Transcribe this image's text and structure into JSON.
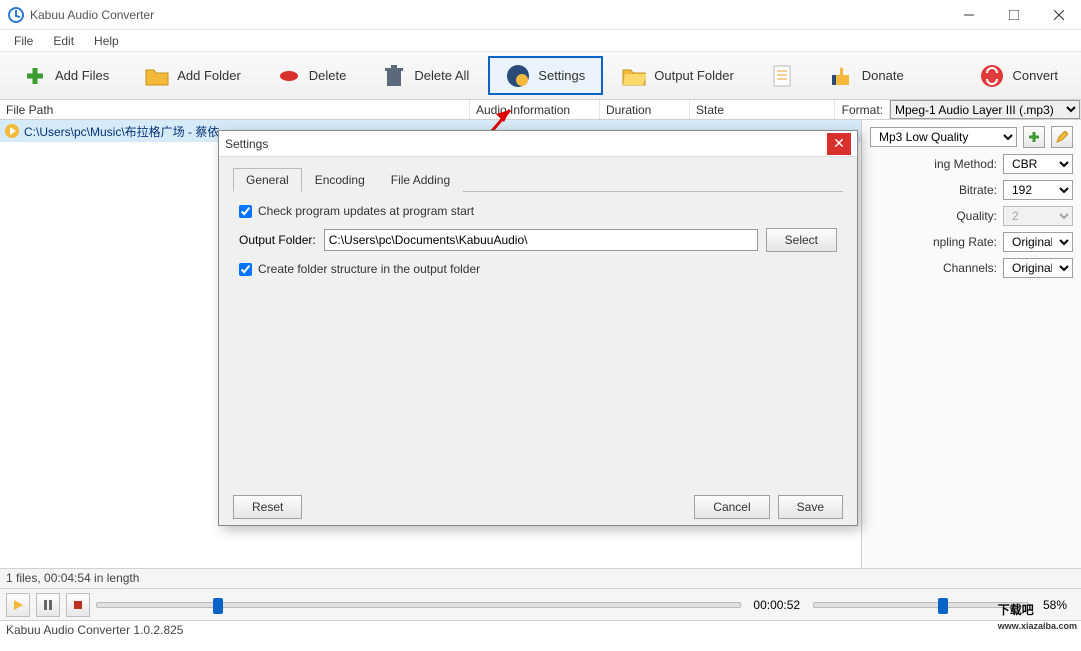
{
  "app": {
    "title": "Kabuu Audio Converter"
  },
  "menubar": {
    "file": "File",
    "edit": "Edit",
    "help": "Help"
  },
  "toolbar": {
    "add_files": "Add Files",
    "add_folder": "Add Folder",
    "delete": "Delete",
    "delete_all": "Delete All",
    "settings": "Settings",
    "output_folder": "Output Folder",
    "donate": "Donate",
    "convert": "Convert"
  },
  "columns": {
    "file_path": "File Path",
    "audio_info": "Audio Information",
    "duration": "Duration",
    "state": "State"
  },
  "filelist": {
    "row0": {
      "path": "C:\\Users\\pc\\Music\\布拉格广场 - 蔡依"
    }
  },
  "side": {
    "format_label": "Format:",
    "format_value": "Mpeg-1 Audio Layer III (.mp3)",
    "preset_value": "Mp3 Low Quality",
    "encoding_method_label": "ing Method:",
    "encoding_method_value": "CBR",
    "bitrate_label": "Bitrate:",
    "bitrate_value": "192",
    "quality_label": "Quality:",
    "quality_value": "2",
    "sampling_rate_label": "npling Rate:",
    "sampling_rate_value": "Original",
    "channels_label": "Channels:",
    "channels_value": "Original"
  },
  "status": {
    "summary": "1 files, 00:04:54 in length"
  },
  "player": {
    "time": "00:00:52",
    "percent": "58%"
  },
  "version": {
    "text": "Kabuu Audio Converter 1.0.2.825"
  },
  "dialog": {
    "title": "Settings",
    "tabs": {
      "general": "General",
      "encoding": "Encoding",
      "file_adding": "File Adding"
    },
    "check_updates": "Check program updates at program start",
    "output_folder_label": "Output Folder:",
    "output_folder_value": "C:\\Users\\pc\\Documents\\KabuuAudio\\",
    "select": "Select",
    "create_folder_structure": "Create folder structure in the output folder",
    "reset": "Reset",
    "cancel": "Cancel",
    "save": "Save"
  },
  "watermark": {
    "big": "下载吧",
    "small": "www.xiazaiba.com"
  }
}
